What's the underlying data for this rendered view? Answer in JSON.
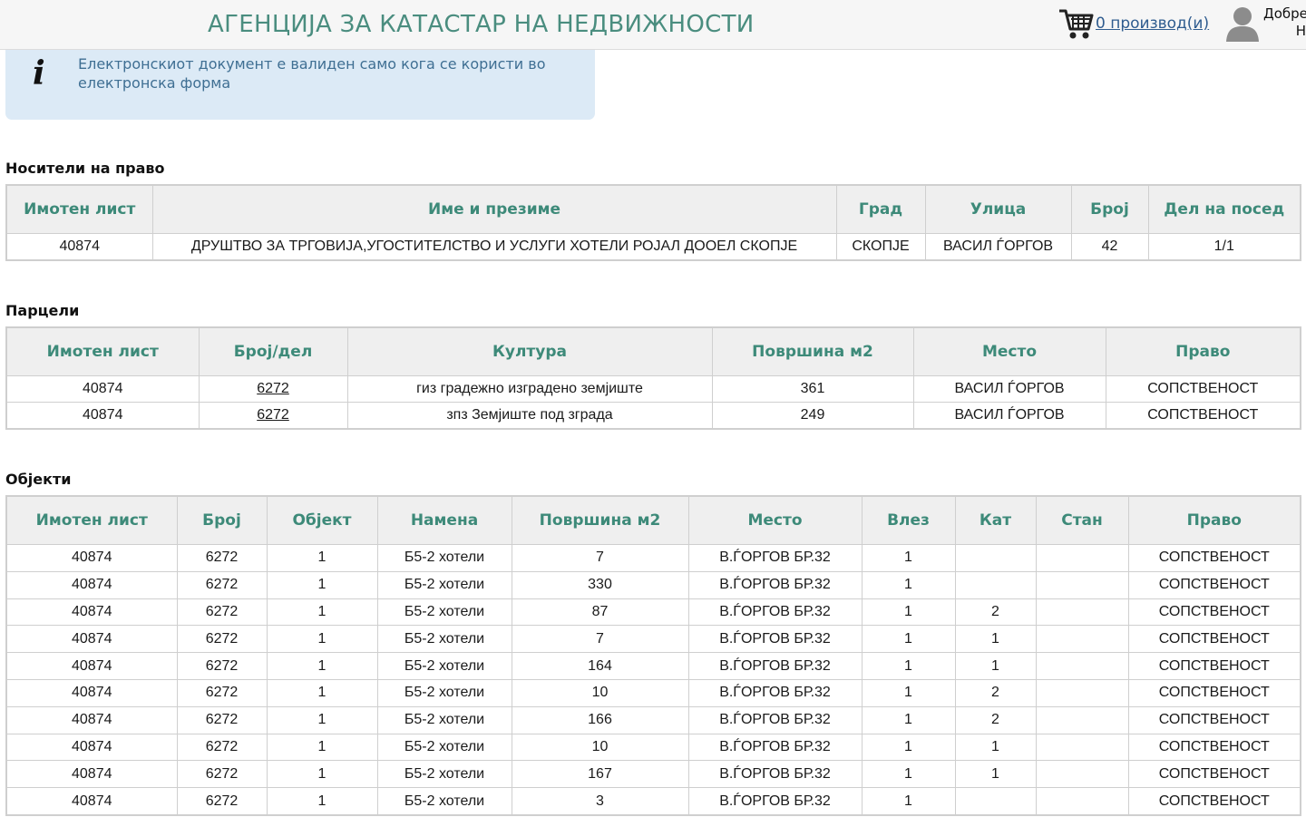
{
  "header": {
    "title": "АГЕНЦИЈА ЗА КАТАСТАР НА НЕДВИЖНОСТИ",
    "cart_label": "0 производ(и)",
    "greeting_line1": "Добре",
    "greeting_line2": "Н"
  },
  "info": {
    "text_line1": "Електронскиот документ е валиден само кога се користи во",
    "text_line2": "електронска форма"
  },
  "colors": {
    "title": "#4a8d7f",
    "table_header_text": "#3d8a79",
    "info_background": "#dceaf6",
    "info_text": "#3f6f93",
    "link": "#2f5c8f"
  },
  "icons": [
    "cart-icon",
    "user-avatar-icon",
    "info-icon"
  ],
  "holders": {
    "title": "Носители на право",
    "columns": [
      "Имотен лист",
      "Име и презиме",
      "Град",
      "Улица",
      "Број",
      "Дел на посед"
    ],
    "rows": [
      [
        "40874",
        "ДРУШТВО ЗА ТРГОВИЈА,УГОСТИТЕЛСТВО И УСЛУГИ ХОТЕЛИ РОЈАЛ ДООЕЛ СКОПЈЕ",
        "СКОПЈЕ",
        "ВАСИЛ ЃОРГОВ",
        "42",
        "1/1"
      ]
    ]
  },
  "parcels": {
    "title": "Парцели",
    "columns": [
      "Имотен лист",
      "Број/дел",
      "Култура",
      "Површина м2",
      "Место",
      "Право"
    ],
    "rows": [
      [
        "40874",
        "6272",
        "гиз градежно изградено земјиште",
        "361",
        "ВАСИЛ ЃОРГОВ",
        "СОПСТВЕНОСТ"
      ],
      [
        "40874",
        "6272",
        "зпз Земјиште под зграда",
        "249",
        "ВАСИЛ ЃОРГОВ",
        "СОПСТВЕНОСТ"
      ]
    ]
  },
  "objects": {
    "title": "Објекти",
    "columns": [
      "Имотен лист",
      "Број",
      "Објект",
      "Намена",
      "Површина м2",
      "Место",
      "Влез",
      "Кат",
      "Стан",
      "Право"
    ],
    "rows": [
      [
        "40874",
        "6272",
        "1",
        "Б5-2 хотели",
        "7",
        "В.ЃОРГОВ БР.32",
        "1",
        "",
        "",
        "СОПСТВЕНОСТ"
      ],
      [
        "40874",
        "6272",
        "1",
        "Б5-2 хотели",
        "330",
        "В.ЃОРГОВ БР.32",
        "1",
        "",
        "",
        "СОПСТВЕНОСТ"
      ],
      [
        "40874",
        "6272",
        "1",
        "Б5-2 хотели",
        "87",
        "В.ЃОРГОВ БР.32",
        "1",
        "2",
        "",
        "СОПСТВЕНОСТ"
      ],
      [
        "40874",
        "6272",
        "1",
        "Б5-2 хотели",
        "7",
        "В.ЃОРГОВ БР.32",
        "1",
        "1",
        "",
        "СОПСТВЕНОСТ"
      ],
      [
        "40874",
        "6272",
        "1",
        "Б5-2 хотели",
        "164",
        "В.ЃОРГОВ БР.32",
        "1",
        "1",
        "",
        "СОПСТВЕНОСТ"
      ],
      [
        "40874",
        "6272",
        "1",
        "Б5-2 хотели",
        "10",
        "В.ЃОРГОВ БР.32",
        "1",
        "2",
        "",
        "СОПСТВЕНОСТ"
      ],
      [
        "40874",
        "6272",
        "1",
        "Б5-2 хотели",
        "166",
        "В.ЃОРГОВ БР.32",
        "1",
        "2",
        "",
        "СОПСТВЕНОСТ"
      ],
      [
        "40874",
        "6272",
        "1",
        "Б5-2 хотели",
        "10",
        "В.ЃОРГОВ БР.32",
        "1",
        "1",
        "",
        "СОПСТВЕНОСТ"
      ],
      [
        "40874",
        "6272",
        "1",
        "Б5-2 хотели",
        "167",
        "В.ЃОРГОВ БР.32",
        "1",
        "1",
        "",
        "СОПСТВЕНОСТ"
      ],
      [
        "40874",
        "6272",
        "1",
        "Б5-2 хотели",
        "3",
        "В.ЃОРГОВ БР.32",
        "1",
        "",
        "",
        "СОПСТВЕНОСТ"
      ]
    ]
  }
}
